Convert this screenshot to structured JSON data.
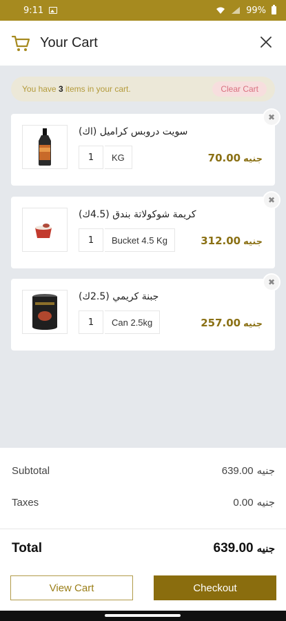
{
  "status_bar": {
    "time": "9:11",
    "battery": "99%",
    "icons": [
      "image-icon",
      "wifi-icon",
      "signal-icon",
      "battery-icon"
    ]
  },
  "header": {
    "title": "Your Cart",
    "icon": "cart-icon",
    "close_icon": "close-icon"
  },
  "info": {
    "prefix": "You have ",
    "count": "3",
    "suffix": " items in your cart.",
    "clear_label": "Clear Cart"
  },
  "items": [
    {
      "name": "سويت دروبس كراميل (اك)",
      "qty": "1",
      "unit": "KG",
      "price": "70.00",
      "currency": "جنيه"
    },
    {
      "name": "كريمة شوكولاتة بندق (4.5ك)",
      "qty": "1",
      "unit": "Bucket 4.5 Kg",
      "price": "312.00",
      "currency": "جنيه"
    },
    {
      "name": "جبنة كريمي (2.5ك)",
      "qty": "1",
      "unit": "Can 2.5kg",
      "price": "257.00",
      "currency": "جنيه"
    }
  ],
  "summary": {
    "subtotal_label": "Subtotal",
    "subtotal_value": "639.00",
    "subtotal_currency": "جنيه",
    "taxes_label": "Taxes",
    "taxes_value": "0.00",
    "taxes_currency": "جنيه",
    "total_label": "Total",
    "total_value": "639.00",
    "total_currency": "جنيه"
  },
  "buttons": {
    "view_cart": "View Cart",
    "checkout": "Checkout"
  },
  "colors": {
    "brand": "#a68a1f",
    "accent": "#8a6d0e",
    "price": "#8a7014",
    "clear_bg": "#f7dede",
    "clear_text": "#d97080"
  }
}
